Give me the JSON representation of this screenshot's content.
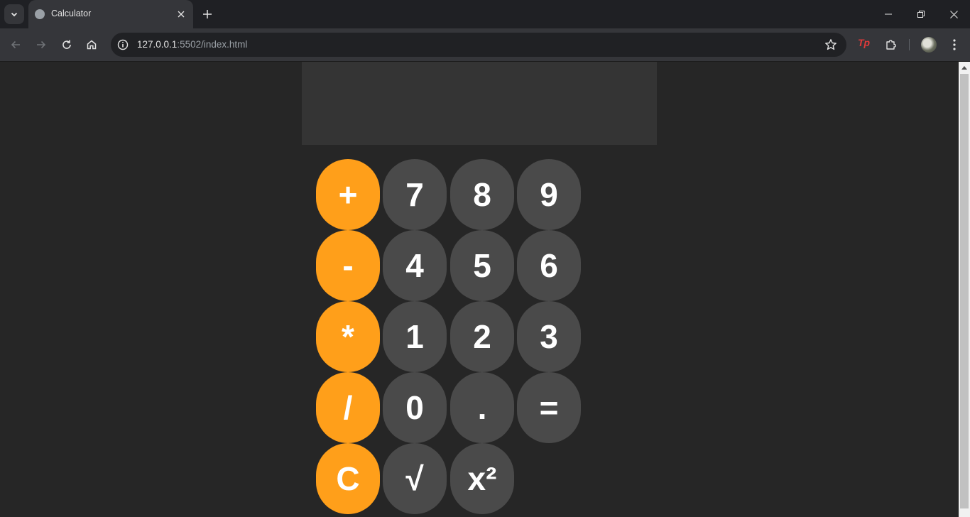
{
  "browser": {
    "tab_title": "Calculator",
    "url_host": "127.0.0.1",
    "url_rest": ":5502/index.html",
    "extension_label": "Tp"
  },
  "calculator": {
    "display_value": "",
    "keys": [
      {
        "label": "+",
        "type": "operator"
      },
      {
        "label": "7",
        "type": "digit"
      },
      {
        "label": "8",
        "type": "digit"
      },
      {
        "label": "9",
        "type": "digit"
      },
      {
        "label": "-",
        "type": "operator"
      },
      {
        "label": "4",
        "type": "digit"
      },
      {
        "label": "5",
        "type": "digit"
      },
      {
        "label": "6",
        "type": "digit"
      },
      {
        "label": "*",
        "type": "operator"
      },
      {
        "label": "1",
        "type": "digit"
      },
      {
        "label": "2",
        "type": "digit"
      },
      {
        "label": "3",
        "type": "digit"
      },
      {
        "label": "/",
        "type": "operator"
      },
      {
        "label": "0",
        "type": "digit"
      },
      {
        "label": ".",
        "type": "digit"
      },
      {
        "label": "=",
        "type": "digit"
      },
      {
        "label": "C",
        "type": "operator"
      },
      {
        "label": "√",
        "type": "digit"
      },
      {
        "label": "x²",
        "type": "digit"
      }
    ]
  },
  "colors": {
    "operator_key": "#ff9f1a",
    "digit_key": "#4a4a4a",
    "page_background": "#262626",
    "display_background": "#343434"
  },
  "icons": {
    "tab_search": "chevron-down-icon",
    "favicon": "globe-icon",
    "back": "arrow-left-icon",
    "forward": "arrow-right-icon",
    "reload": "reload-icon",
    "home": "home-icon",
    "site_info": "info-icon",
    "bookmark": "star-icon",
    "extensions": "puzzle-icon",
    "menu": "kebab-icon"
  }
}
